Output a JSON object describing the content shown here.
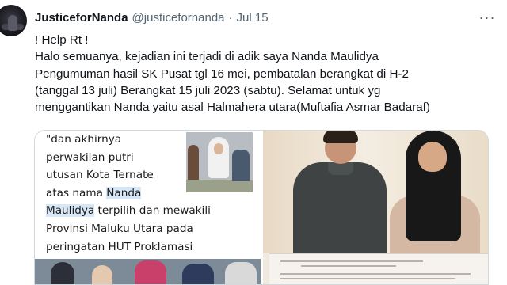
{
  "tweet": {
    "display_name": "JusticeforNanda",
    "handle": "@justicefornanda",
    "separator": "·",
    "date": "Jul 15",
    "more_label": "···",
    "body_lines": [
      "! Help Rt !",
      "Halo semuanya, kejadian ini terjadi di adik saya Nanda Maulidya",
      "Pengumuman hasil SK Pusat tgl 16 mei, pembatalan berangkat di H-2",
      "(tanggal 13 juli) Berangkat 15 juli 2023 (sabtu). Selamat untuk yg",
      "menggantikan Nanda yaitu asal Halmahera utara(Muftafia Asmar Badaraf)"
    ]
  },
  "media": {
    "caption": {
      "line1": "\"dan akhirnya",
      "line2": "perwakilan putri",
      "line3": "utusan Kota Ternate",
      "line4_pre": "atas nama ",
      "line4_hl": "Nanda",
      "line5_hl": "Maulidya",
      "line5_post": " terpilih dan mewakili",
      "line6": "Provinsi Maluku Utara pada",
      "line7": "peringatan HUT Proklamasi"
    }
  }
}
